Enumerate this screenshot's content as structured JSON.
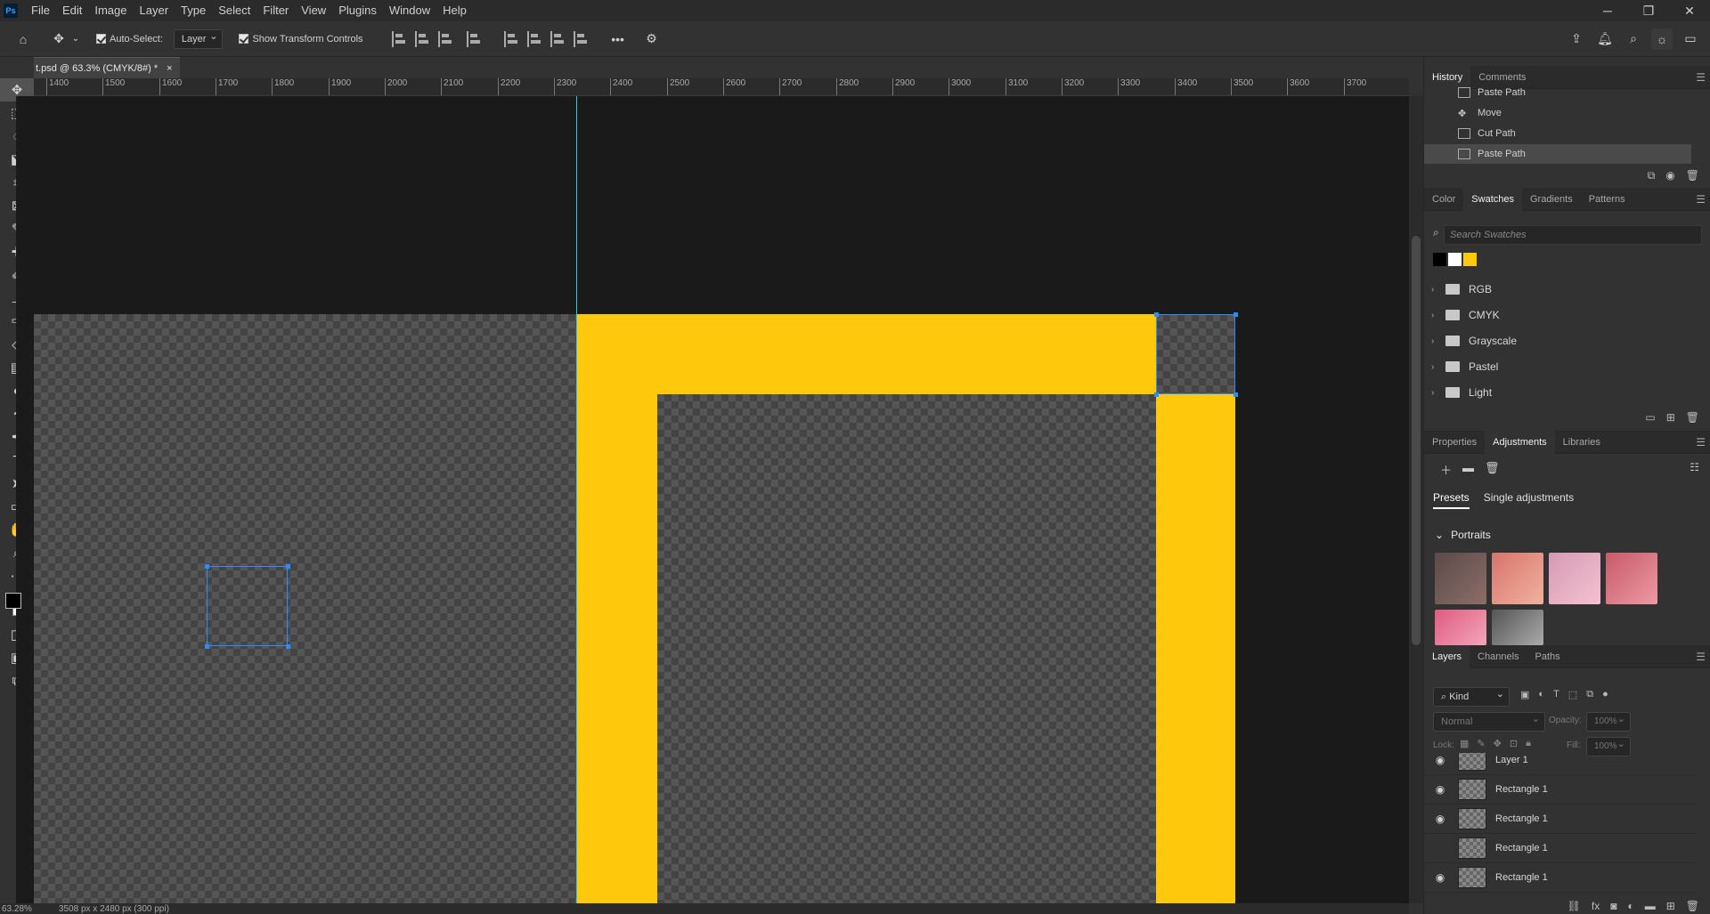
{
  "menu": {
    "logo": "Ps",
    "items": [
      "File",
      "Edit",
      "Image",
      "Layer",
      "Type",
      "Select",
      "Filter",
      "View",
      "Plugins",
      "Window",
      "Help"
    ]
  },
  "window": {
    "minimize": "─",
    "restore": "❐",
    "close": "✕"
  },
  "options": {
    "auto_select_label": "Auto-Select:",
    "auto_select_value": "Layer",
    "transform_label": "Show Transform Controls",
    "more": "•••"
  },
  "document": {
    "tab_title": "t.psd @ 63.3% (CMYK/8#) *",
    "close": "×"
  },
  "ruler": {
    "ticks": [
      "1400",
      "1500",
      "1600",
      "1700",
      "1800",
      "1900",
      "2000",
      "2100",
      "2200",
      "2300",
      "2400",
      "2500",
      "2600",
      "2700",
      "2800",
      "2900",
      "3000",
      "3100",
      "3200",
      "3300",
      "3400",
      "3500",
      "3600",
      "3700"
    ]
  },
  "status": {
    "zoom": "63.28%",
    "size": "3508 px x 2480 px (300 ppi)"
  },
  "history": {
    "tabs": [
      "History",
      "Comments"
    ],
    "rows": [
      "Paste Path",
      "Move",
      "Cut Path",
      "Paste Path"
    ],
    "selected_index": 3
  },
  "swatches": {
    "tabs": [
      "Color",
      "Swatches",
      "Gradients",
      "Patterns"
    ],
    "search_placeholder": "Search Swatches",
    "recent": [
      "#000000",
      "#ffffff",
      "#fec80c"
    ],
    "folders": [
      "RGB",
      "CMYK",
      "Grayscale",
      "Pastel",
      "Light"
    ]
  },
  "adjustments": {
    "tabs": [
      "Properties",
      "Adjustments",
      "Libraries"
    ],
    "subtabs": [
      "Presets",
      "Single adjustments"
    ],
    "group": "Portraits"
  },
  "layers": {
    "tabs": [
      "Layers",
      "Channels",
      "Paths"
    ],
    "kind": "Kind",
    "blend": "Normal",
    "opacity_label": "Opacity:",
    "opacity": "100%",
    "lock_label": "Lock:",
    "fill_label": "Fill:",
    "fill": "100%",
    "rows": [
      {
        "name": "Layer 1",
        "visible": true
      },
      {
        "name": "Rectangle 1",
        "visible": true
      },
      {
        "name": "Rectangle 1",
        "visible": true
      },
      {
        "name": "Rectangle 1",
        "visible": false
      },
      {
        "name": "Rectangle 1",
        "visible": true
      }
    ]
  },
  "colors": {
    "accent_yellow": "#fec80c",
    "selection_blue": "#2d8cff",
    "guide_cyan": "#3ccad3"
  }
}
